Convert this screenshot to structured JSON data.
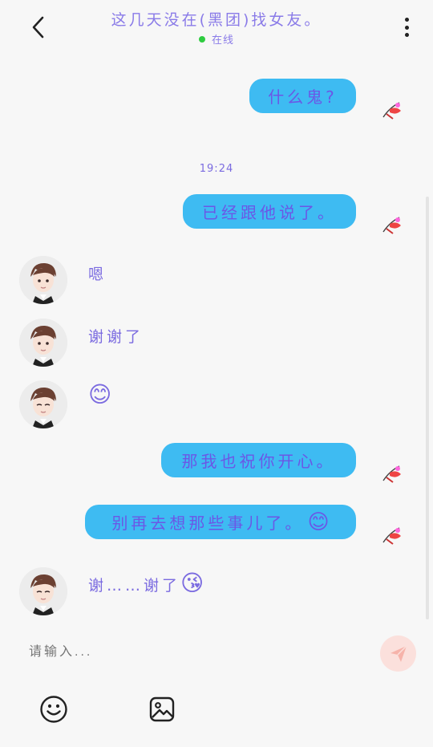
{
  "header": {
    "title": "这几天没在(黑团)找女友。",
    "status": "在线",
    "status_color": "#2ecc40"
  },
  "messages": [
    {
      "side": "right",
      "text": "什么鬼?"
    },
    {
      "type": "time",
      "text": "19:24"
    },
    {
      "side": "right",
      "text": "已经跟他说了。"
    },
    {
      "side": "left",
      "text": "嗯"
    },
    {
      "side": "left",
      "text": "谢谢了"
    },
    {
      "side": "left",
      "text": "😊"
    },
    {
      "side": "right",
      "text": "那我也祝你开心。"
    },
    {
      "side": "right",
      "text": "别再去想那些事儿了。",
      "emoji": "😊"
    },
    {
      "side": "left",
      "text": "谢……谢了",
      "emoji": "😘"
    }
  ],
  "composer": {
    "placeholder": "请输入..."
  },
  "icons": {
    "back": "chevron-left-icon",
    "more": "more-vertical-icon",
    "send": "send-icon",
    "emoji": "emoji-icon",
    "image": "image-icon"
  },
  "colors": {
    "bubble": "#3ebbf2",
    "text_purple": "#7b6be0",
    "send_bg": "#fbe0dc"
  }
}
